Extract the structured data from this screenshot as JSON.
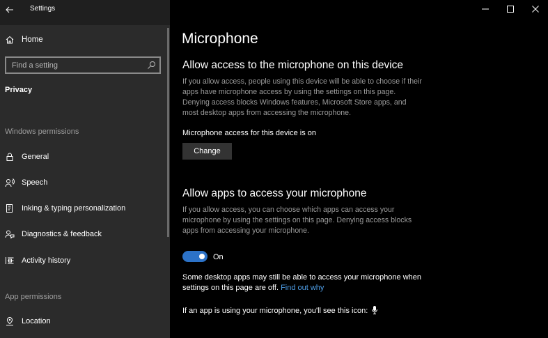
{
  "window": {
    "title": "Settings",
    "controls": [
      "minimize-icon",
      "maximize-icon",
      "close-icon"
    ]
  },
  "sidebar": {
    "home_label": "Home",
    "search_placeholder": "Find a setting",
    "section": "Privacy",
    "groups": [
      {
        "label": "Windows permissions",
        "items": [
          {
            "label": "General",
            "icon": "lock-icon"
          },
          {
            "label": "Speech",
            "icon": "speech-icon"
          },
          {
            "label": "Inking & typing personalization",
            "icon": "inking-icon"
          },
          {
            "label": "Diagnostics & feedback",
            "icon": "feedback-icon"
          },
          {
            "label": "Activity history",
            "icon": "history-icon"
          }
        ]
      },
      {
        "label": "App permissions",
        "items": [
          {
            "label": "Location",
            "icon": "location-icon"
          }
        ]
      }
    ]
  },
  "main": {
    "title": "Microphone",
    "device_section": {
      "heading": "Allow access to the microphone on this device",
      "description": "If you allow access, people using this device will be able to choose if their apps have microphone access by using the settings on this page. Denying access blocks Windows features, Microsoft Store apps, and most desktop apps from accessing the microphone.",
      "status": "Microphone access for this device is on",
      "button_label": "Change"
    },
    "apps_section": {
      "heading": "Allow apps to access your microphone",
      "description": "If you allow access, you can choose which apps can access your microphone by using the settings on this page. Denying access blocks apps from accessing your microphone.",
      "toggle_state": "On",
      "toggle_color": "#2c72c7",
      "note_text": "Some desktop apps may still be able to access your microphone when settings on this page are off.",
      "note_link": "Find out why",
      "icon_note": "If an app is using your microphone, you'll see this icon:"
    }
  }
}
